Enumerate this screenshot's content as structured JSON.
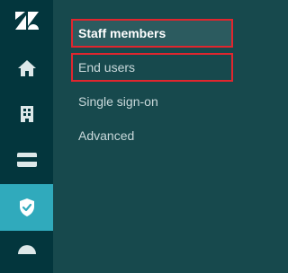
{
  "rail": {
    "items": [
      {
        "name": "zendesk-logo",
        "icon": "zendesk-logo-icon"
      },
      {
        "name": "home",
        "icon": "home-icon"
      },
      {
        "name": "organizations",
        "icon": "building-icon"
      },
      {
        "name": "billing",
        "icon": "credit-card-icon"
      },
      {
        "name": "security",
        "icon": "shield-check-icon",
        "active": true
      },
      {
        "name": "more",
        "icon": "half-circle-icon"
      }
    ],
    "active_color": "#30aabc",
    "background": "#03363d"
  },
  "subnav": {
    "background": "#17494d",
    "items": [
      {
        "label": "Staff members",
        "active": true,
        "highlighted": true
      },
      {
        "label": "End users",
        "active": false,
        "highlighted": true
      },
      {
        "label": "Single sign-on",
        "active": false,
        "highlighted": false
      },
      {
        "label": "Advanced",
        "active": false,
        "highlighted": false
      }
    ],
    "highlight_color": "#e0262e"
  }
}
